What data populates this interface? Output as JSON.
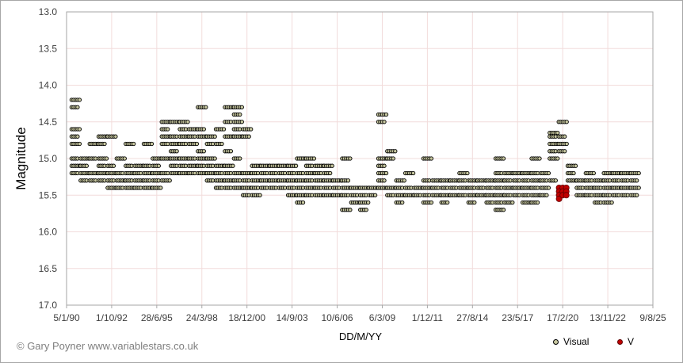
{
  "chart_data": {
    "type": "scatter",
    "title": "",
    "xlabel": "DD/M/YY",
    "ylabel": "Magnitude",
    "y_inverted": true,
    "ylim": [
      13.0,
      17.0
    ],
    "y_ticks": [
      "13.0",
      "13.5",
      "14.0",
      "14.5",
      "15.0",
      "15.5",
      "16.0",
      "16.5",
      "17.0"
    ],
    "x_ticks": [
      "5/1/90",
      "1/10/92",
      "28/6/95",
      "24/3/98",
      "18/12/00",
      "14/9/03",
      "10/6/06",
      "6/3/09",
      "1/12/11",
      "27/8/14",
      "23/5/17",
      "17/2/20",
      "13/11/22",
      "9/8/25"
    ],
    "grid": true,
    "legend_position": "bottom-right",
    "series": [
      {
        "name": "Visual",
        "marker_fill": "#c8c8a0",
        "marker_edge": "#000000",
        "clusters": [
          {
            "x": 0.5,
            "mags": [
              14.2,
              14.3,
              14.6,
              14.7,
              14.8,
              15.0,
              15.1,
              15.2
            ]
          },
          {
            "x": 1.0,
            "mags": [
              15.0,
              15.1,
              15.2,
              15.3
            ]
          },
          {
            "x": 1.5,
            "mags": [
              14.8,
              15.0,
              15.2,
              15.3
            ]
          },
          {
            "x": 2.0,
            "mags": [
              14.7,
              14.8,
              15.0,
              15.1,
              15.2,
              15.3
            ]
          },
          {
            "x": 2.5,
            "mags": [
              14.7,
              15.1,
              15.2,
              15.3,
              15.4
            ]
          },
          {
            "x": 3.0,
            "mags": [
              15.0,
              15.2,
              15.3,
              15.4
            ]
          },
          {
            "x": 3.5,
            "mags": [
              14.8,
              15.1,
              15.2,
              15.3,
              15.4
            ]
          },
          {
            "x": 4.0,
            "mags": [
              15.1,
              15.2,
              15.3,
              15.4
            ]
          },
          {
            "x": 4.5,
            "mags": [
              14.8,
              15.1,
              15.2,
              15.3,
              15.4
            ]
          },
          {
            "x": 5.0,
            "mags": [
              15.0,
              15.1,
              15.2,
              15.3,
              15.4
            ]
          },
          {
            "x": 5.5,
            "mags": [
              14.5,
              14.6,
              14.7,
              14.8,
              15.0,
              15.2,
              15.3
            ]
          },
          {
            "x": 6.0,
            "mags": [
              14.5,
              14.7,
              14.8,
              14.9,
              15.0,
              15.1,
              15.2
            ]
          },
          {
            "x": 6.5,
            "mags": [
              14.5,
              14.6,
              14.7,
              14.8,
              15.0,
              15.1,
              15.2
            ]
          },
          {
            "x": 7.0,
            "mags": [
              14.6,
              14.7,
              14.8,
              15.0,
              15.1,
              15.2
            ]
          },
          {
            "x": 7.5,
            "mags": [
              14.3,
              14.6,
              14.7,
              14.9,
              15.0,
              15.1,
              15.2
            ]
          },
          {
            "x": 8.0,
            "mags": [
              14.7,
              14.8,
              15.0,
              15.1,
              15.2,
              15.3
            ]
          },
          {
            "x": 8.5,
            "mags": [
              14.6,
              14.8,
              15.1,
              15.2,
              15.3,
              15.4
            ]
          },
          {
            "x": 9.0,
            "mags": [
              14.3,
              14.5,
              14.7,
              14.9,
              15.1,
              15.2,
              15.3,
              15.4
            ]
          },
          {
            "x": 9.5,
            "mags": [
              14.3,
              14.4,
              14.5,
              14.6,
              14.7,
              15.0,
              15.2,
              15.3,
              15.4
            ]
          },
          {
            "x": 10.0,
            "mags": [
              14.6,
              14.7,
              15.2,
              15.3,
              15.4,
              15.5
            ]
          },
          {
            "x": 10.5,
            "mags": [
              15.1,
              15.2,
              15.3,
              15.4,
              15.5
            ]
          },
          {
            "x": 11.0,
            "mags": [
              15.1,
              15.2,
              15.3,
              15.4
            ]
          },
          {
            "x": 11.5,
            "mags": [
              15.1,
              15.2,
              15.3,
              15.4
            ]
          },
          {
            "x": 12.0,
            "mags": [
              15.1,
              15.2,
              15.3,
              15.4
            ]
          },
          {
            "x": 12.5,
            "mags": [
              15.1,
              15.2,
              15.3,
              15.4,
              15.5
            ]
          },
          {
            "x": 13.0,
            "mags": [
              15.0,
              15.2,
              15.3,
              15.4,
              15.5,
              15.6
            ]
          },
          {
            "x": 13.5,
            "mags": [
              15.0,
              15.1,
              15.2,
              15.3,
              15.4,
              15.5
            ]
          },
          {
            "x": 14.0,
            "mags": [
              15.1,
              15.2,
              15.3,
              15.4,
              15.5
            ]
          },
          {
            "x": 14.5,
            "mags": [
              15.1,
              15.2,
              15.3,
              15.4,
              15.5
            ]
          },
          {
            "x": 15.0,
            "mags": [
              15.3,
              15.4,
              15.5
            ]
          },
          {
            "x": 15.5,
            "mags": [
              15.0,
              15.3,
              15.4,
              15.5,
              15.7
            ]
          },
          {
            "x": 16.0,
            "mags": [
              15.4,
              15.5,
              15.6
            ]
          },
          {
            "x": 16.5,
            "mags": [
              15.4,
              15.5,
              15.6,
              15.7
            ]
          },
          {
            "x": 17.0,
            "mags": [
              15.4,
              15.5
            ]
          },
          {
            "x": 17.5,
            "mags": [
              14.4,
              14.5,
              15.0,
              15.1,
              15.2,
              15.3,
              15.4
            ]
          },
          {
            "x": 18.0,
            "mags": [
              14.9,
              15.0,
              15.4,
              15.5
            ]
          },
          {
            "x": 18.5,
            "mags": [
              15.3,
              15.4,
              15.5,
              15.6
            ]
          },
          {
            "x": 19.0,
            "mags": [
              15.2,
              15.4,
              15.5
            ]
          },
          {
            "x": 19.5,
            "mags": [
              15.4,
              15.5
            ]
          },
          {
            "x": 20.0,
            "mags": [
              15.0,
              15.3,
              15.4,
              15.5,
              15.6
            ]
          },
          {
            "x": 20.5,
            "mags": [
              15.3,
              15.4,
              15.5
            ]
          },
          {
            "x": 21.0,
            "mags": [
              15.3,
              15.4,
              15.5,
              15.6
            ]
          },
          {
            "x": 21.5,
            "mags": [
              15.3,
              15.4,
              15.5
            ]
          },
          {
            "x": 22.0,
            "mags": [
              15.2,
              15.3,
              15.4,
              15.5
            ]
          },
          {
            "x": 22.5,
            "mags": [
              15.3,
              15.4,
              15.5,
              15.6
            ]
          },
          {
            "x": 23.0,
            "mags": [
              15.3,
              15.4,
              15.5
            ]
          },
          {
            "x": 23.5,
            "mags": [
              15.3,
              15.4,
              15.5,
              15.6
            ]
          },
          {
            "x": 24.0,
            "mags": [
              15.0,
              15.2,
              15.3,
              15.4,
              15.5,
              15.6,
              15.7
            ]
          },
          {
            "x": 24.5,
            "mags": [
              15.2,
              15.3,
              15.4,
              15.5,
              15.6
            ]
          },
          {
            "x": 25.0,
            "mags": [
              15.2,
              15.3,
              15.4,
              15.5
            ]
          },
          {
            "x": 25.5,
            "mags": [
              15.2,
              15.3,
              15.4,
              15.5,
              15.6
            ]
          },
          {
            "x": 26.0,
            "mags": [
              15.0,
              15.2,
              15.3,
              15.4,
              15.5,
              15.6
            ]
          },
          {
            "x": 26.5,
            "mags": [
              15.2,
              15.3,
              15.4,
              15.5
            ]
          },
          {
            "x": 27.0,
            "mags": [
              14.65,
              14.7,
              14.8,
              14.9,
              15.0,
              15.3
            ]
          },
          {
            "x": 27.5,
            "mags": [
              14.5,
              14.7,
              14.8,
              14.9
            ]
          },
          {
            "x": 28.0,
            "mags": [
              15.1,
              15.2,
              15.3
            ]
          },
          {
            "x": 28.5,
            "mags": [
              15.3,
              15.4,
              15.5
            ]
          },
          {
            "x": 29.0,
            "mags": [
              15.2,
              15.3,
              15.4,
              15.5
            ]
          },
          {
            "x": 29.5,
            "mags": [
              15.3,
              15.4,
              15.5,
              15.6
            ]
          },
          {
            "x": 30.0,
            "mags": [
              15.2,
              15.3,
              15.4,
              15.5,
              15.6
            ]
          },
          {
            "x": 30.5,
            "mags": [
              15.2,
              15.3,
              15.4,
              15.5
            ]
          },
          {
            "x": 31.0,
            "mags": [
              15.2,
              15.3,
              15.4,
              15.5
            ]
          },
          {
            "x": 31.5,
            "mags": [
              15.2,
              15.3,
              15.4,
              15.5
            ]
          }
        ]
      },
      {
        "name": "V",
        "marker_fill": "#c00000",
        "marker_edge": "#600000",
        "clusters": [
          {
            "x": 27.3,
            "mags": [
              15.4,
              15.45,
              15.5,
              15.55
            ]
          },
          {
            "x": 27.5,
            "mags": [
              15.4,
              15.45,
              15.5
            ]
          },
          {
            "x": 27.7,
            "mags": [
              15.4,
              15.45,
              15.5
            ]
          }
        ]
      }
    ],
    "x_note": "x expressed in tick-interval units from first tick (0 = 5/1/90, 13 = 9/8/25)"
  },
  "footer": {
    "copyright": "© Gary Poyner  www.variablestars.co.uk"
  }
}
